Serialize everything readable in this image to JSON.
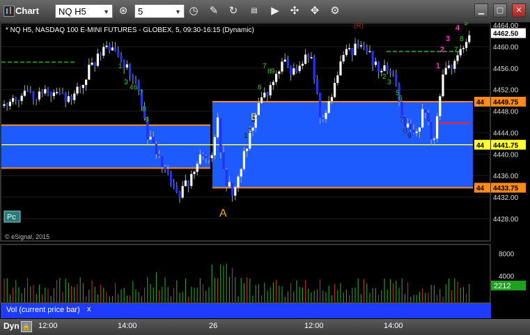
{
  "window": {
    "title": "Chart"
  },
  "toolbar": {
    "symbol": "NQ H5",
    "interval": "5",
    "icons": [
      "target-icon",
      "clock-icon",
      "pencil-icon",
      "cycle-icon",
      "news-icon",
      "play-icon",
      "tools-icon",
      "gear-icon"
    ]
  },
  "chart": {
    "header": "* NQ H5, NASDAQ 100 E-MINI FUTURES - GLOBEX, 5, 09:30-16:15 (Dynamic)",
    "watermark": "© eSignal, 2015",
    "pc_label": "Pc",
    "top_marker": "(R)",
    "annotations": {
      "A": "A",
      "B": "B"
    },
    "price_axis": [
      "4464.00",
      "4460.00",
      "4456.00",
      "4452.00",
      "4448.00",
      "4444.00",
      "4440.00",
      "4436.00",
      "4432.00",
      "4428.00"
    ],
    "price_tags": [
      {
        "label": "4462.50",
        "price": 4462.5,
        "bg": "#ffffff",
        "fg": "#000000",
        "left": ""
      },
      {
        "label": "4449.75",
        "price": 4449.75,
        "bg": "#ff8c1a",
        "fg": "#000000",
        "left": "44"
      },
      {
        "label": "4441.75",
        "price": 4441.75,
        "bg": "#ffff33",
        "fg": "#000000",
        "left": "44"
      },
      {
        "label": "4433.75",
        "price": 4433.75,
        "bg": "#ff8c1a",
        "fg": "#000000",
        "left": "44"
      }
    ],
    "colors": {
      "up": "#ffffff",
      "down": "#2233ee",
      "zone": "#1e5bff",
      "orange": "#ff8c1a",
      "yellow": "#ffff33",
      "green": "#1f8f1f"
    },
    "series_count_labels": [
      "1",
      "2",
      "3",
      "4",
      "5",
      "6",
      "7",
      "8",
      "9"
    ]
  },
  "volume": {
    "label": "Vol (current price bar)",
    "close": "x",
    "axis": [
      "8000",
      "4000"
    ],
    "current": "2212"
  },
  "status": {
    "dyn": "Dyn",
    "times": [
      "12:00",
      "14:00",
      "26",
      "12:00",
      "14:00"
    ]
  }
}
